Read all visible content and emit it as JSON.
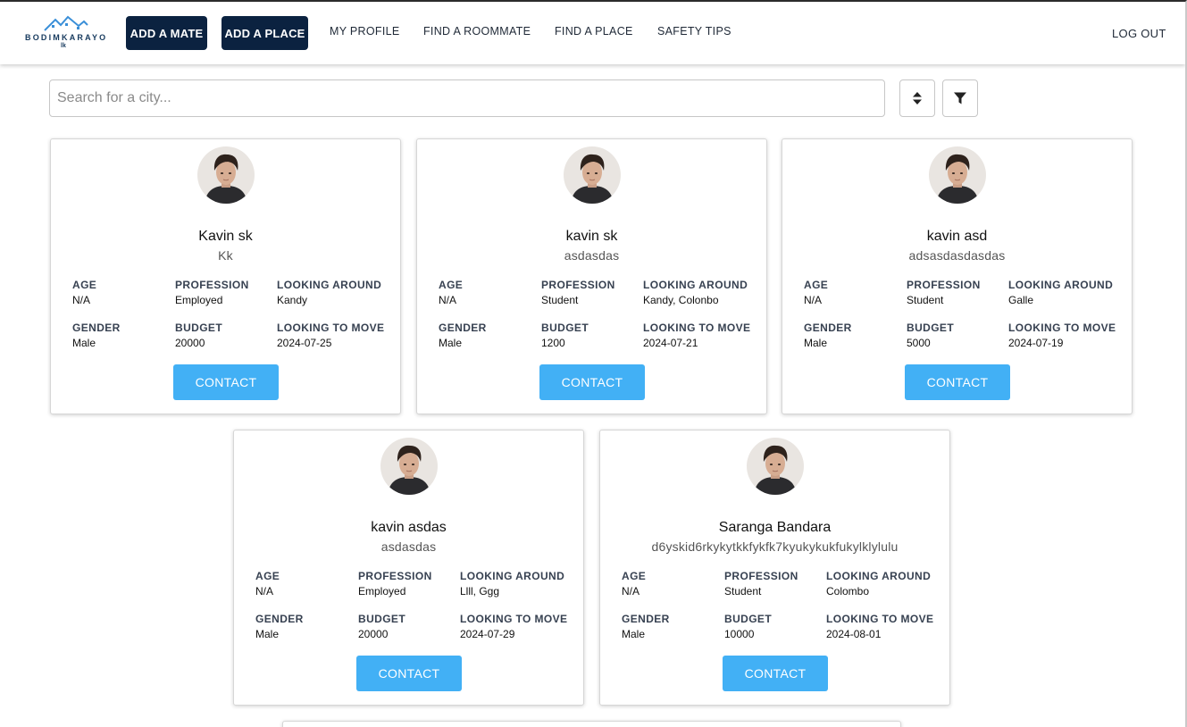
{
  "header": {
    "logo_text": "BODIMKARAYO",
    "logo_sub": "lk",
    "add_mate_label": "ADD A MATE",
    "add_place_label": "ADD A PLACE",
    "my_profile_label": "MY PROFILE",
    "find_roommate_label": "FIND A ROOMMATE",
    "find_place_label": "FIND A PLACE",
    "safety_tips_label": "SAFETY TIPS",
    "logout_label": "LOG OUT"
  },
  "search": {
    "placeholder": "Search for a city...",
    "value": ""
  },
  "icons": {
    "sort": "sort-icon",
    "filter": "filter-icon"
  },
  "field_labels": {
    "age": "AGE",
    "profession": "PROFESSION",
    "looking_around": "LOOKING AROUND",
    "gender": "GENDER",
    "budget": "BUDGET",
    "looking_to_move": "LOOKING TO MOVE"
  },
  "contact_label": "CONTACT",
  "colors": {
    "nav_dark": "#0b2240",
    "contact": "#42b0f5"
  },
  "cards": [
    {
      "name": "Kavin sk",
      "subtitle": "Kk",
      "age": "N/A",
      "profession": "Employed",
      "looking_around": "Kandy",
      "gender": "Male",
      "budget": "20000",
      "looking_to_move": "2024-07-25"
    },
    {
      "name": "kavin sk",
      "subtitle": "asdasdas",
      "age": "N/A",
      "profession": "Student",
      "looking_around": "Kandy, Colonbo",
      "gender": "Male",
      "budget": "1200",
      "looking_to_move": "2024-07-21"
    },
    {
      "name": "kavin asd",
      "subtitle": "adsasdasdasdas",
      "age": "N/A",
      "profession": "Student",
      "looking_around": "Galle",
      "gender": "Male",
      "budget": "5000",
      "looking_to_move": "2024-07-19"
    },
    {
      "name": "kavin asdas",
      "subtitle": "asdasdas",
      "age": "N/A",
      "profession": "Employed",
      "looking_around": "Llll, Ggg",
      "gender": "Male",
      "budget": "20000",
      "looking_to_move": "2024-07-29"
    },
    {
      "name": "Saranga Bandara",
      "subtitle": "d6yskid6rkykytkkfykfk7kyukykukfukylklylulu",
      "age": "N/A",
      "profession": "Student",
      "looking_around": "Colombo",
      "gender": "Male",
      "budget": "10000",
      "looking_to_move": "2024-08-01"
    }
  ]
}
